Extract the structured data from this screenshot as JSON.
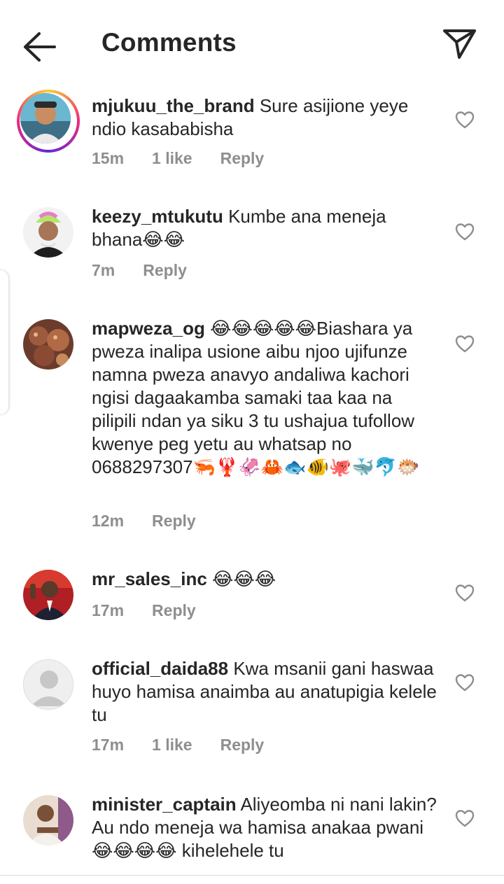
{
  "header": {
    "title": "Comments",
    "back_icon": "arrow-left-icon",
    "send_icon": "paper-plane-icon"
  },
  "comments": [
    {
      "username": "mjukuu_the_brand",
      "text": "Sure asijione yeye ndio kasababisha",
      "time": "15m",
      "likes": "1 like",
      "reply": "Reply",
      "has_story": true
    },
    {
      "username": "keezy_mtukutu",
      "text": "Kumbe ana meneja bhana😂😂",
      "time": "7m",
      "reply": "Reply"
    },
    {
      "username": "mapweza_og",
      "text": "😂😂😂😂😂Biashara ya pweza inalipa usione aibu njoo ujifunze namna pweza anavyo andaliwa kachori ngisi dagaakamba samaki taa kaa na pilipili ndan ya siku 3 tu ushajua tufollow kwenye peg yetu au whatsap no 0688297307🦐🦞🦑🦀🐟🐠🐙🐳🐬🐡",
      "time": "12m",
      "reply": "Reply"
    },
    {
      "username": "mr_sales_inc",
      "text": "😂😂😂",
      "time": "17m",
      "reply": "Reply"
    },
    {
      "username": "official_daida88",
      "text": "Kwa msanii gani haswaa huyo hamisa anaimba au anatupigia kelele tu",
      "time": "17m",
      "likes": "1 like",
      "reply": "Reply"
    },
    {
      "username": "minister_captain",
      "text": "Aliyeomba ni nani lakin? Au ndo meneja wa hamisa anakaa pwani😂😂😂😂 kihelehele tu"
    }
  ],
  "colors": {
    "text": "#262626",
    "secondary": "#8e8e8e",
    "divider": "#dbdbdb"
  }
}
